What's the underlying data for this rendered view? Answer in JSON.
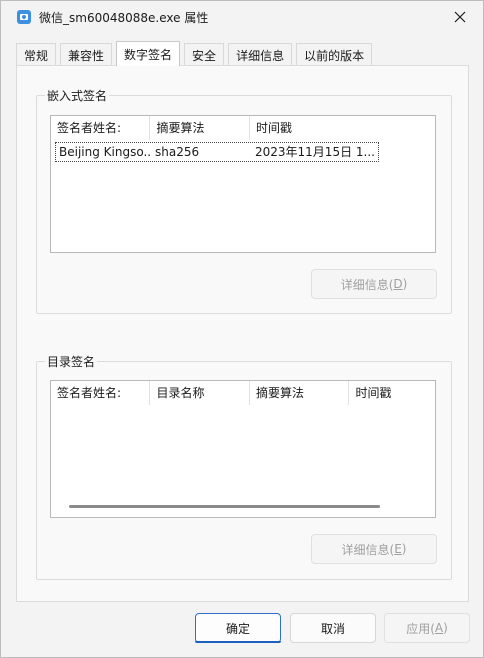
{
  "window": {
    "title": "微信_sm60048088e.exe 属性"
  },
  "tabs": [
    {
      "label": "常规"
    },
    {
      "label": "兼容性"
    },
    {
      "label": "数字签名"
    },
    {
      "label": "安全"
    },
    {
      "label": "详细信息"
    },
    {
      "label": "以前的版本"
    }
  ],
  "embedded": {
    "label": "嵌入式签名",
    "columns": [
      "签名者姓名:",
      "摘要算法",
      "时间戳"
    ],
    "rows": [
      {
        "signer": "Beijing Kingso...",
        "algorithm": "sha256",
        "timestamp": "2023年11月15日 1..."
      }
    ],
    "details_button": {
      "text": "详细信息(",
      "key": "D",
      "close": ")"
    }
  },
  "catalog": {
    "label": "目录签名",
    "columns": [
      "签名者姓名:",
      "目录名称",
      "摘要算法",
      "时间戳"
    ],
    "details_button": {
      "text": "详细信息(",
      "key": "E",
      "close": ")"
    }
  },
  "footer": {
    "ok": "确定",
    "cancel": "取消",
    "apply": {
      "text": "应用(",
      "key": "A",
      "close": ")"
    }
  },
  "colors": {
    "accent": "#1d5fbf",
    "icon": "#3d8fe0"
  }
}
